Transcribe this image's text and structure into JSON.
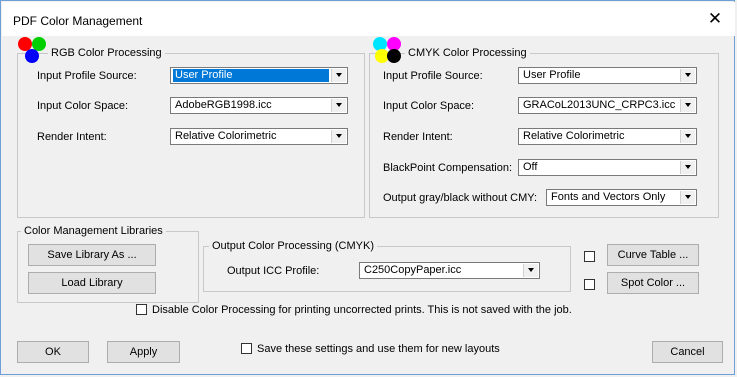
{
  "window": {
    "title": "PDF Color Management"
  },
  "rgb": {
    "title": "RGB Color Processing",
    "input_profile_source": {
      "label": "Input Profile Source:",
      "value": "User Profile"
    },
    "input_color_space": {
      "label": "Input Color Space:",
      "value": "AdobeRGB1998.icc"
    },
    "render_intent": {
      "label": "Render Intent:",
      "value": "Relative Colorimetric"
    }
  },
  "cmyk": {
    "title": "CMYK Color Processing",
    "input_profile_source": {
      "label": "Input Profile Source:",
      "value": "User Profile"
    },
    "input_color_space": {
      "label": "Input Color Space:",
      "value": "GRACoL2013UNC_CRPC3.icc"
    },
    "render_intent": {
      "label": "Render Intent:",
      "value": "Relative Colorimetric"
    },
    "blackpoint": {
      "label": "BlackPoint Compensation:",
      "value": "Off"
    },
    "output_gray": {
      "label": "Output gray/black without CMY:",
      "value": "Fonts and Vectors Only"
    }
  },
  "libraries": {
    "title": "Color Management Libraries",
    "save_label": "Save Library As ...",
    "load_label": "Load Library"
  },
  "output": {
    "title": "Output Color Processing (CMYK)",
    "icc_label": "Output ICC Profile:",
    "icc_value": "C250CopyPaper.icc"
  },
  "side_buttons": {
    "curve_table": "Curve Table ...",
    "spot_color": "Spot Color ..."
  },
  "disable_processing": {
    "label": "Disable Color Processing for printing uncorrected prints. This is not saved with the job.",
    "checked": false
  },
  "footer": {
    "ok": "OK",
    "apply": "Apply",
    "save_settings": "Save these settings and use them for new layouts",
    "cancel": "Cancel"
  },
  "colors": {
    "selection": "#0078d7",
    "rgb_red": "#ff0000",
    "rgb_green": "#00d000",
    "rgb_blue": "#0000ff",
    "cmyk_cyan": "#00e5ff",
    "cmyk_magenta": "#ff00ff",
    "cmyk_yellow": "#ffff00",
    "cmyk_black": "#000000"
  }
}
